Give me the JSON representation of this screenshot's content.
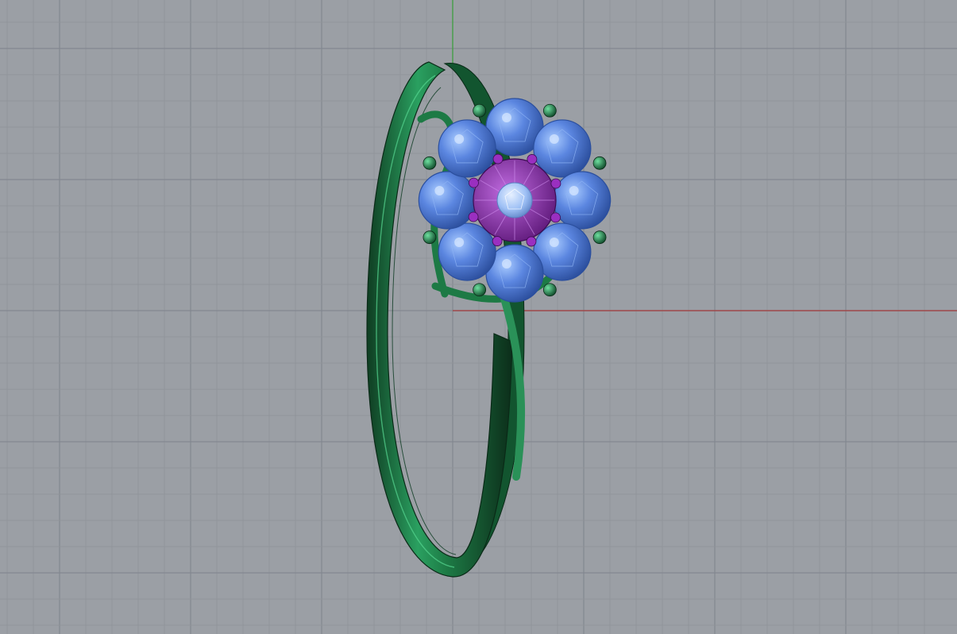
{
  "viewport": {
    "view": "Front",
    "display_mode": "Shaded",
    "colors": {
      "background": "#9b9fa5",
      "grid_minor": "#8f9399",
      "grid_major": "#838890",
      "axis_x": "#a33a3a",
      "axis_y": "#3aa13a",
      "metal": "#1f7a45",
      "metal_dark": "#0f3d22",
      "metal_light": "#4fcf86",
      "stone": "#4b78d6",
      "stone_light": "#9cc2ff",
      "center_metal": "#7a1f9a",
      "center_stone": "#a9cbff"
    }
  },
  "model": {
    "object": "ring",
    "petal_stones": 8,
    "center_stones": 1
  }
}
